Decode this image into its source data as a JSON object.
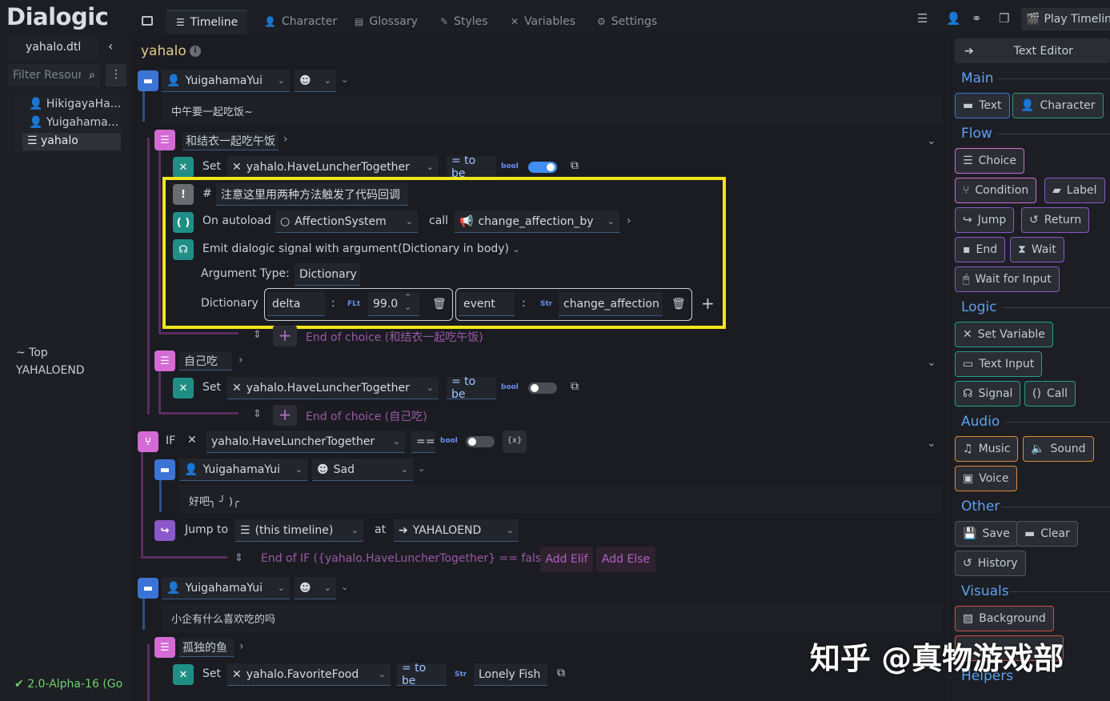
{
  "app": {
    "logo": "Dialogic",
    "version": "2.0-Alpha-16 (Go"
  },
  "tabs": {
    "timeline": "Timeline",
    "character": "Character",
    "glossary": "Glossary",
    "styles": "Styles",
    "variables": "Variables",
    "settings": "Settings",
    "play": "Play Timeline"
  },
  "sidebar": {
    "file": "yahalo.dtl",
    "filter_placeholder": "Filter Resources",
    "resources": [
      "HikigayaHa...",
      "Yuigahama...",
      "yahalo"
    ],
    "labels": [
      "~ Top",
      "YAHALOEND"
    ]
  },
  "timeline": {
    "title": "yahalo",
    "e1": {
      "character": "YuigahamaYui",
      "text": "中午要一起吃饭~"
    },
    "choice1": {
      "text": "和结衣一起吃午饭",
      "end": "End of choice (和结衣一起吃午饭)"
    },
    "set1": {
      "label": "Set",
      "var": "yahalo.HaveLuncherTogether",
      "op": "= to be",
      "type": "bool"
    },
    "comment": {
      "hash": "#",
      "text": "注意这里用两种方法触发了代码回调"
    },
    "call": {
      "label": "On autoload",
      "autoload": "AffectionSystem",
      "call": "call",
      "method": "change_affection_by"
    },
    "signal": {
      "label": "Emit dialogic signal with argument",
      "mode": "(Dictionary in body)",
      "argtype_label": "Argument Type:",
      "argtype": "Dictionary",
      "dict_label": "Dictionary",
      "k1": "delta",
      "t1": "FLt",
      "v1": "99.0",
      "k2": "event",
      "t2": "Str",
      "v2": "change_affection",
      "colon": ":"
    },
    "choice2": {
      "text": "自己吃",
      "end": "End of choice (自己吃)"
    },
    "set2": {
      "label": "Set",
      "var": "yahalo.HaveLuncherTogether",
      "op": "= to be",
      "type": "bool"
    },
    "if": {
      "label": "IF",
      "var": "yahalo.HaveLuncherTogether",
      "op": "==",
      "type": "bool",
      "end": "End of IF ({yahalo.HaveLuncherTogether} == false)",
      "add_elif": "Add Elif",
      "add_else": "Add Else"
    },
    "e2": {
      "character": "YuigahamaYui",
      "portrait": "Sad",
      "text": "好吧╮ ╯ )╭"
    },
    "jump": {
      "label": "Jump to",
      "timeline": "(this timeline)",
      "at": "at",
      "target": "YAHALOEND"
    },
    "e3": {
      "character": "YuigahamaYui",
      "text": "小企有什么喜欢吃的吗"
    },
    "choice3": {
      "text": "孤独的鱼"
    },
    "set3": {
      "label": "Set",
      "var": "yahalo.FavoriteFood",
      "op": "= to be",
      "type": "Str",
      "value": "Lonely Fish"
    }
  },
  "rpanel": {
    "editor": "Text Editor",
    "sections": {
      "main": "Main",
      "flow": "Flow",
      "logic": "Logic",
      "audio": "Audio",
      "other": "Other",
      "visuals": "Visuals",
      "helpers": "Helpers"
    },
    "buttons": {
      "text": "Text",
      "character": "Character",
      "choice": "Choice",
      "condition": "Condition",
      "label": "Label",
      "jump": "Jump",
      "return": "Return",
      "end": "End",
      "wait": "Wait",
      "wait_input": "Wait for Input",
      "set_variable": "Set Variable",
      "text_input": "Text Input",
      "signal": "Signal",
      "call": "Call",
      "music": "Music",
      "sound": "Sound",
      "voice": "Voice",
      "save": "Save",
      "clear": "Clear",
      "history": "History",
      "background": "Background"
    }
  },
  "watermark": "知乎 @真物游戏部"
}
